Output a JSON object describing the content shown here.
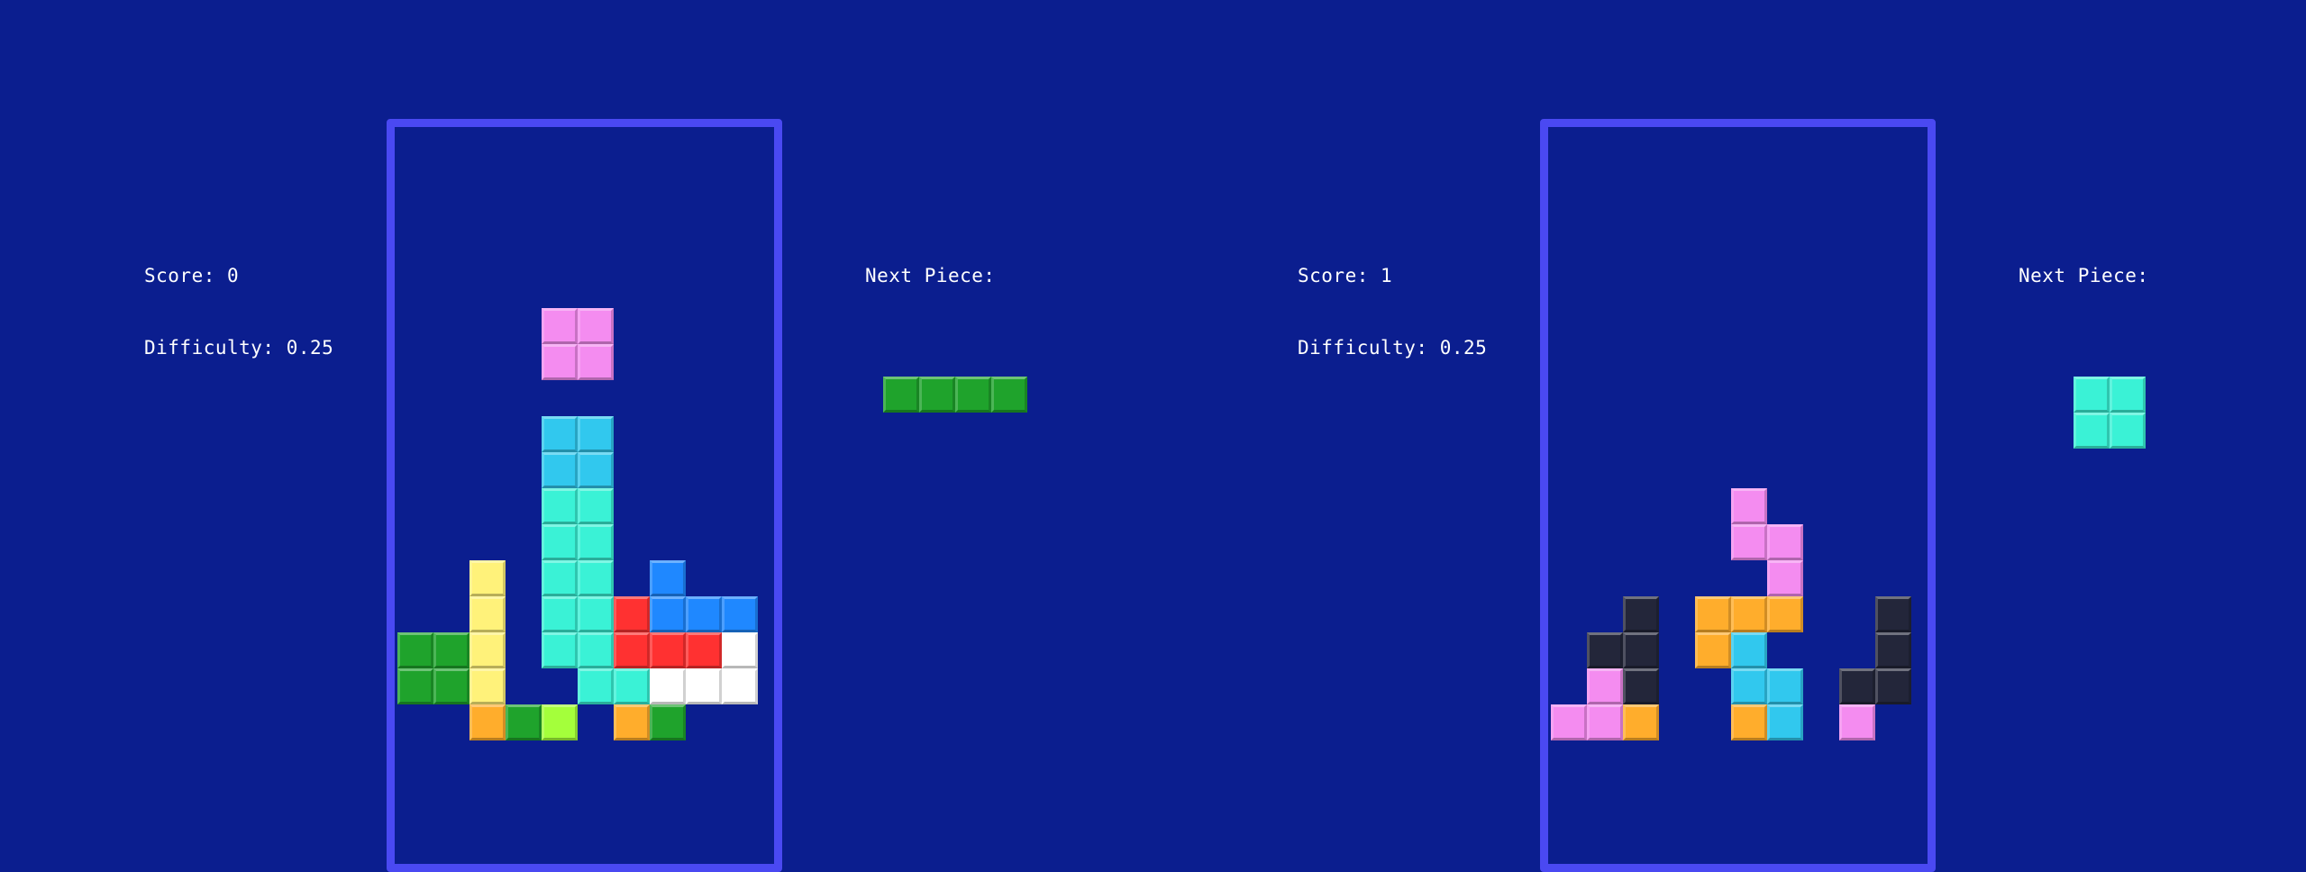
{
  "colors": {
    "background": "#0b1e8f",
    "board_border": "#4a49f2",
    "palette": {
      "G": "#1fa32c",
      "Y": "#fff27a",
      "O": "#ffad2c",
      "L": "#a4ff3b",
      "C": "#3af2d6",
      "K": "#31c8ee",
      "P": "#f48cf0",
      "R": "#ff3131",
      "W": "#ffffff",
      "B": "#1f88ff",
      "D": "#23263a"
    }
  },
  "players": [
    {
      "score_label": "Score: 0",
      "difficulty_label": "Difficulty: 0.25",
      "next_label": "Next Piece:",
      "next_piece": [
        "GGGG"
      ],
      "board": [
        "..........",
        "..........",
        "..........",
        "..........",
        "..........",
        "....PP....",
        "....PP....",
        "..........",
        "....KK....",
        "....KK....",
        "....CC....",
        "....CC....",
        "..Y.CC.B..",
        "..Y.CCRBBB",
        "GGY.CCRRRW",
        "GGY..CCWWW",
        "..OGL.OG.."
      ]
    },
    {
      "score_label": "Score: 1",
      "difficulty_label": "Difficulty: 0.25",
      "next_label": "Next Piece:",
      "next_piece": [
        "CC",
        "CC"
      ],
      "board": [
        "..........",
        "..........",
        "..........",
        "..........",
        "..........",
        "..........",
        "..........",
        "..........",
        "..........",
        "..........",
        ".....P....",
        ".....PP...",
        "......P...",
        "..D.OOO..D",
        ".DD.OK...D",
        ".PD..KK.DD",
        "PPO..OK.P."
      ]
    }
  ]
}
